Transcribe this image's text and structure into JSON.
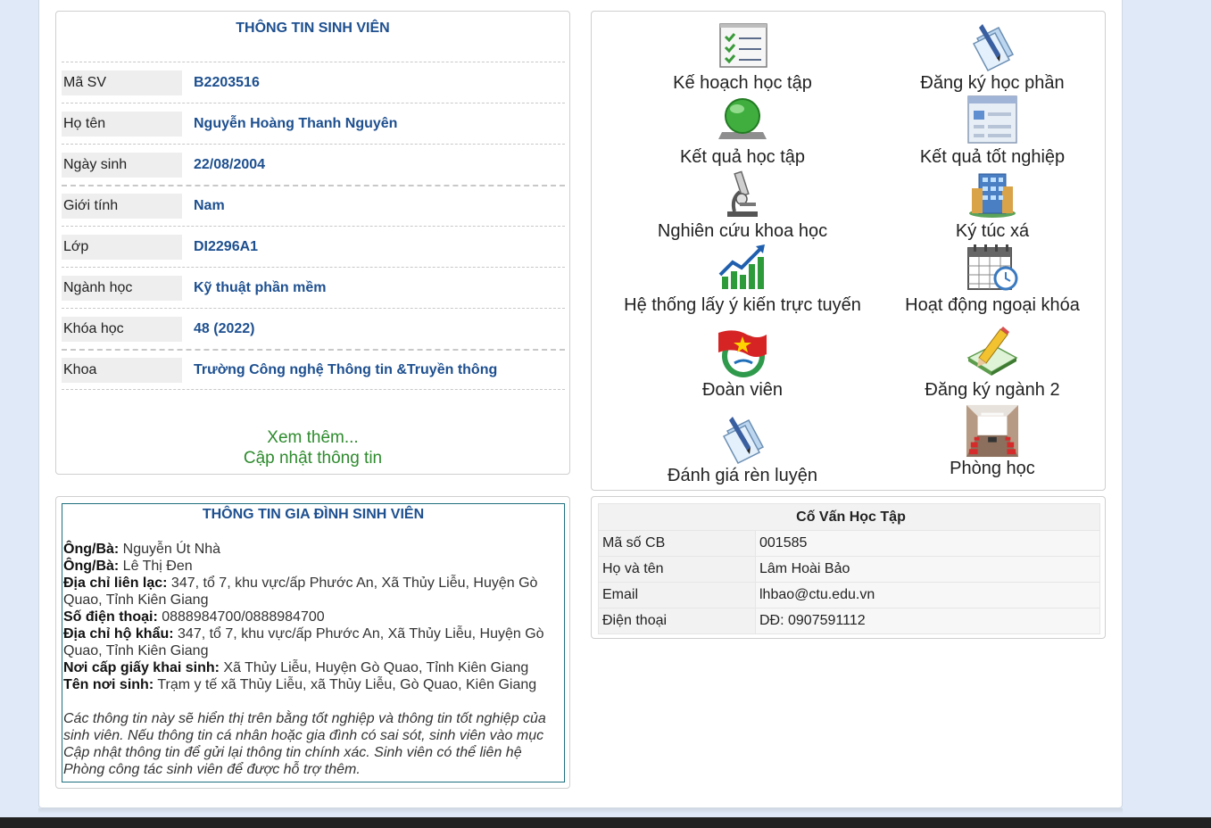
{
  "student": {
    "title": "THÔNG TIN SINH VIÊN",
    "rows": [
      {
        "label": "Mã SV",
        "value": "B2203516"
      },
      {
        "label": "Họ tên",
        "value": "Nguyễn Hoàng Thanh Nguyên"
      },
      {
        "label": "Ngày sinh",
        "value": "22/08/2004"
      },
      {
        "label": "Giới tính",
        "value": "Nam"
      },
      {
        "label": "Lớp",
        "value": "DI2296A1"
      },
      {
        "label": "Ngành học",
        "value": "Kỹ thuật phần mềm"
      },
      {
        "label": "Khóa học",
        "value": "48 (2022)"
      },
      {
        "label": "Khoa",
        "value": "Trường Công nghệ Thông tin &Truyền thông"
      }
    ],
    "more_link": "Xem thêm...",
    "update_link": "Cập nhật thông tin"
  },
  "menu": {
    "items": [
      {
        "label": "Kế hoạch học tập",
        "icon": "checklist-icon"
      },
      {
        "label": "Đăng ký học phần",
        "icon": "document-pen-icon"
      },
      {
        "label": "Kết quả học tập",
        "icon": "globe-monitor-icon"
      },
      {
        "label": "Kết quả tốt nghiệp",
        "icon": "window-form-icon"
      },
      {
        "label": "Nghiên cứu khoa học",
        "icon": "microscope-icon"
      },
      {
        "label": "Ký túc xá",
        "icon": "building-icon"
      },
      {
        "label": "Hệ thống lấy ý kiến trực tuyến",
        "icon": "growth-chart-icon"
      },
      {
        "label": "Hoạt động ngoại khóa",
        "icon": "calendar-clock-icon"
      },
      {
        "label": "Đoàn viên",
        "icon": "youth-union-flag-icon"
      },
      {
        "label": "Đăng ký ngành 2",
        "icon": "notebook-pencil-icon"
      },
      {
        "label": "Đánh giá rèn luyện",
        "icon": "document-pen-icon"
      },
      {
        "label": "Phòng học",
        "icon": "classroom-icon"
      }
    ]
  },
  "family": {
    "title": "THÔNG TIN GIA ĐÌNH SINH VIÊN",
    "lines": [
      {
        "label": "Ông/Bà:",
        "value": " Nguyễn Út Nhà"
      },
      {
        "label": "Ông/Bà:",
        "value": " Lê Thị Đen"
      },
      {
        "label": "Địa chỉ liên lạc:",
        "value": " 347, tổ 7, khu vực/ấp Phước An, Xã Thủy Liễu, Huyện Gò Quao, Tỉnh Kiên Giang"
      },
      {
        "label": "Số điện thoại:",
        "value": " 0888984700/0888984700"
      },
      {
        "label": "Địa chỉ hộ khẩu:",
        "value": " 347, tổ 7, khu vực/ấp Phước An, Xã Thủy Liễu, Huyện Gò Quao, Tỉnh Kiên Giang"
      },
      {
        "label": "Nơi cấp giấy khai sinh:",
        "value": " Xã Thủy Liễu, Huyện Gò Quao, Tỉnh Kiên Giang"
      },
      {
        "label": "Tên nơi sinh:",
        "value": " Trạm y tế xã Thủy Liễu, xã Thủy Liễu, Gò Quao, Kiên Giang"
      }
    ],
    "note": "Các thông tin này sẽ hiển thị trên bằng tốt nghiệp và thông tin tốt nghiệp của sinh viên. Nếu thông tin cá nhân hoặc gia đình có sai sót, sinh viên vào mục Cập nhật thông tin để gửi lại thông tin chính xác. Sinh viên có thể liên hệ Phòng công tác sinh viên để được hỗ trợ thêm."
  },
  "advisor": {
    "title": "Cố Vấn Học Tập",
    "rows": [
      {
        "label": "Mã số CB",
        "value": "001585"
      },
      {
        "label": "Họ và tên",
        "value": "Lâm Hoài Bảo"
      },
      {
        "label": "Email",
        "value": "lhbao@ctu.edu.vn"
      },
      {
        "label": "Điện thoại",
        "value": "DĐ: 0907591112"
      }
    ]
  }
}
